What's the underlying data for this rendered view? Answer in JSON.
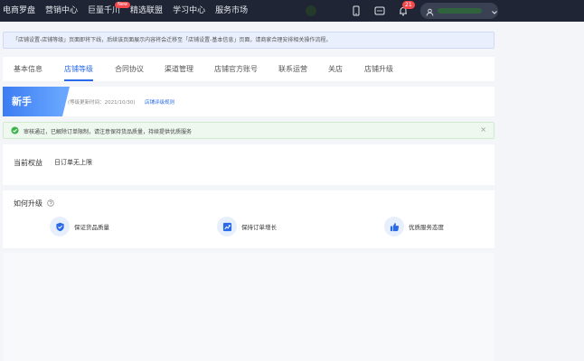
{
  "topnav": {
    "items": [
      {
        "label": "电商罗盘"
      },
      {
        "label": "营销中心"
      },
      {
        "label": "巨量千川",
        "badge": "New"
      },
      {
        "label": "精选联盟"
      },
      {
        "label": "学习中心"
      },
      {
        "label": "服务市场"
      }
    ],
    "bell_count": "21"
  },
  "notice": {
    "text": "「店铺设置-店铺等级」页面即将下线，后续该页面展示内容将会迁移至「店铺设置-基本信息」页面，请商家合理安排相关操作流程。"
  },
  "tabs": [
    {
      "label": "基本信息",
      "active": false
    },
    {
      "label": "店铺等级",
      "active": true
    },
    {
      "label": "合同协议",
      "active": false
    },
    {
      "label": "渠道管理",
      "active": false
    },
    {
      "label": "店铺官方账号",
      "active": false
    },
    {
      "label": "联系运营",
      "active": false
    },
    {
      "label": "关店",
      "active": false
    },
    {
      "label": "店铺升级",
      "active": false
    }
  ],
  "level": {
    "name": "新手",
    "update_time": "(等级更新时间：2021/10/30)",
    "rule_link": "店铺评级规则"
  },
  "alert": {
    "text": "审核通过，已解除订单限制，请注意保持货品质量，持续提供优质服务",
    "close": "×"
  },
  "rights": {
    "label": "当前权益",
    "value": "日订单无上限"
  },
  "upgrade": {
    "title": "如何升级",
    "features": [
      {
        "label": "保证货品质量",
        "icon": "shield-check-icon"
      },
      {
        "label": "保持订单增长",
        "icon": "chart-up-icon"
      },
      {
        "label": "优质服务态度",
        "icon": "thumbs-up-icon"
      }
    ]
  },
  "colors": {
    "nav_bg": "#1f2534",
    "accent": "#2a6ae9",
    "success": "#3cb44b"
  }
}
